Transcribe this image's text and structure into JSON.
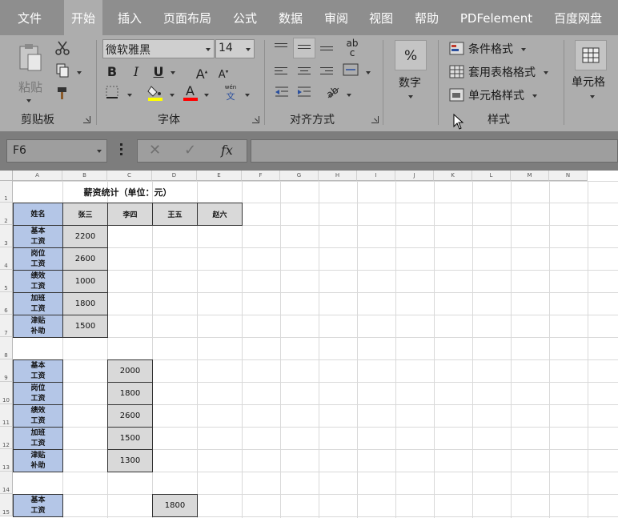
{
  "tabs": [
    {
      "label": "文件",
      "active": false
    },
    {
      "label": "开始",
      "active": true
    },
    {
      "label": "插入",
      "active": false
    },
    {
      "label": "页面布局",
      "active": false
    },
    {
      "label": "公式",
      "active": false
    },
    {
      "label": "数据",
      "active": false
    },
    {
      "label": "审阅",
      "active": false
    },
    {
      "label": "视图",
      "active": false
    },
    {
      "label": "帮助",
      "active": false
    },
    {
      "label": "PDFelement",
      "active": false
    },
    {
      "label": "百度网盘",
      "active": false
    }
  ],
  "ribbon": {
    "clipboard": {
      "paste": "粘贴",
      "group": "剪贴板"
    },
    "font": {
      "name": "微软雅黑",
      "size": "14",
      "group": "字体",
      "bold": "B",
      "italic": "I",
      "underline": "U",
      "pinyin_top": "wén",
      "pinyin_bottom": "文"
    },
    "alignment": {
      "group": "对齐方式",
      "wrap_top": "ab",
      "wrap_bottom": "c"
    },
    "number": {
      "label": "数字",
      "percent": "%"
    },
    "styles": {
      "conditional": "条件格式",
      "table": "套用表格格式",
      "cell": "单元格样式",
      "group": "样式"
    },
    "cells": {
      "label": "单元格"
    }
  },
  "formula_bar": {
    "name_box": "F6",
    "fx": "fx",
    "value": ""
  },
  "sheet": {
    "columns": [
      "A",
      "B",
      "C",
      "D",
      "E",
      "F",
      "G",
      "H",
      "I",
      "J",
      "K",
      "L",
      "M",
      "N"
    ],
    "rows": [
      "1",
      "2",
      "3",
      "4",
      "5",
      "6",
      "7",
      "8",
      "9",
      "10",
      "11",
      "12",
      "13",
      "14",
      "15"
    ],
    "title": "薪资统计（单位：元）",
    "header": [
      "姓名",
      "张三",
      "李四",
      "王五",
      "赵六"
    ],
    "labels": [
      "基本\n工资",
      "岗位\n工资",
      "绩效\n工资",
      "加班\n工资",
      "津贴\n补助"
    ],
    "zhangsan": [
      "2200",
      "2600",
      "1000",
      "1800",
      "1500"
    ],
    "lisi": [
      "2000",
      "1800",
      "2600",
      "1500",
      "1300"
    ],
    "wangwu_first": "1800"
  },
  "colors": {
    "tabbar": "#8e8e8e",
    "ribbon": "#adadad",
    "label_fill": "#b4c6e7",
    "value_fill": "#d9d9d9",
    "font_color_bar": "#ff0000",
    "fill_color_bar": "#ffff00"
  }
}
